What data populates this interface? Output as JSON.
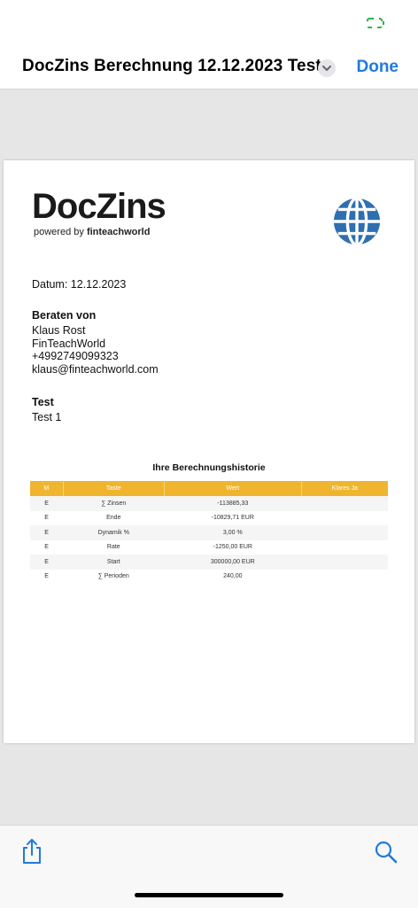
{
  "nav": {
    "title": "DocZins Berechnung 12.12.2023 Test",
    "done_label": "Done"
  },
  "icons": {
    "status": "battery-charging-icon",
    "title_menu": "chevron-down-icon",
    "globe": "globe-icon",
    "share": "share-icon",
    "search": "search-icon"
  },
  "colors": {
    "accent": "#1f7ae0",
    "table_header": "#f0b52e",
    "globe": "#2f6fb1",
    "logo_accent": "#e07b1f"
  },
  "document": {
    "logo": {
      "wordmark": "DocZins",
      "powered_by": "powered by",
      "company": "finteachworld"
    },
    "date_line": "Datum: 12.12.2023",
    "advisor": {
      "heading": "Beraten von",
      "name": "Klaus Rost",
      "company": "FinTeachWorld",
      "phone": "+4992749099323",
      "email": "klaus@finteachworld.com"
    },
    "client": {
      "heading": "Test",
      "name": "Test 1"
    },
    "history": {
      "title": "Ihre Berechnungshistorie",
      "columns": [
        "M",
        "Taste",
        "Wert",
        "Klares Ja"
      ],
      "rows": [
        [
          "E",
          "∑ Zinsen",
          "-113885,33",
          ""
        ],
        [
          "E",
          "Ende",
          "-10829,71 EUR",
          ""
        ],
        [
          "E",
          "Dynamik %",
          "3,00 %",
          ""
        ],
        [
          "E",
          "Rate",
          "-1250,00 EUR",
          ""
        ],
        [
          "E",
          "Start",
          "300000,00 EUR",
          ""
        ],
        [
          "E",
          "∑ Perioden",
          "240,00",
          ""
        ]
      ]
    }
  }
}
